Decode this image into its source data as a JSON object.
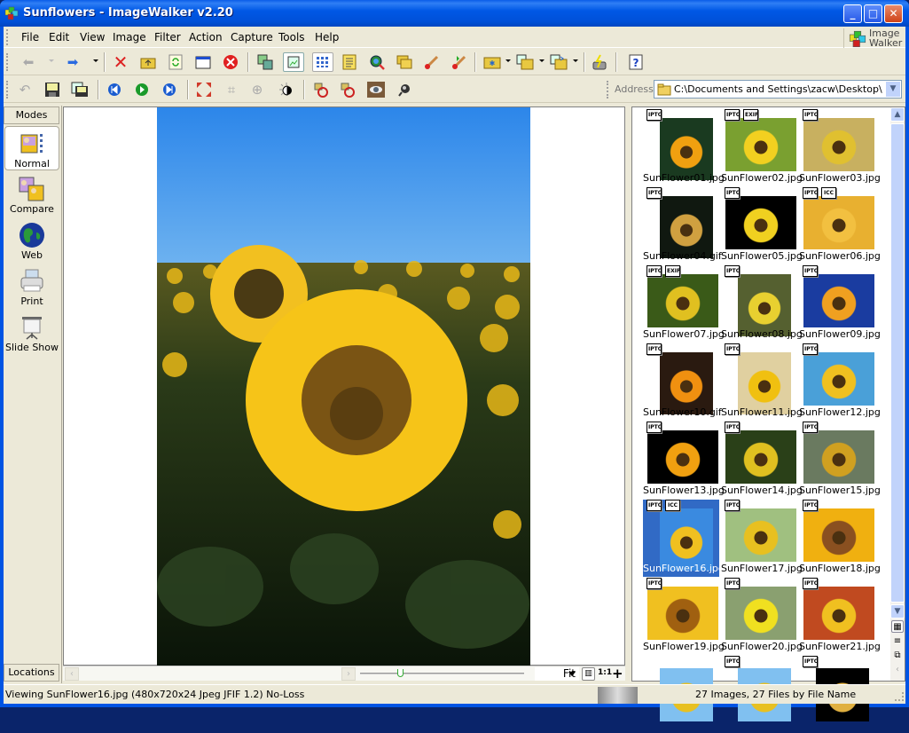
{
  "window": {
    "title": "Sunflowers - ImageWalker v2.20",
    "minimize_label": "_",
    "maximize_label": "□",
    "close_label": "✕"
  },
  "logo": {
    "line1": "Image",
    "line2": "Walker"
  },
  "menu": [
    "File",
    "Edit",
    "View",
    "Image",
    "Filter",
    "Action",
    "Capture",
    "Tools",
    "Help"
  ],
  "toolbar1": {
    "icons": [
      "back-icon",
      "forward-icon",
      "delete-icon",
      "up-folder-icon",
      "refresh-icon",
      "new-window-icon",
      "close-image-icon",
      "batch-convert-icon",
      "single-view-icon",
      "thumbnail-view-icon",
      "notes-icon",
      "web-search-icon",
      "folders-icon",
      "touch-up-icon",
      "auto-touch-up-icon",
      "new-folder-icon",
      "copy-to-icon",
      "move-to-icon",
      "capture-icon",
      "help-icon"
    ]
  },
  "toolbar2": {
    "icons": [
      "undo-icon",
      "save-icon",
      "save-as-icon",
      "previous-image-icon",
      "play-slideshow-icon",
      "next-image-icon",
      "fit-icon",
      "crop-icon",
      "resize-icon",
      "brightness-icon",
      "rotate-left-icon",
      "rotate-right-icon",
      "red-eye-icon",
      "effects-icon"
    ],
    "address_label": "Address",
    "address_value": "C:\\Documents and Settings\\zacw\\Desktop\\Images"
  },
  "modes": {
    "header": "Modes",
    "items": [
      {
        "label": "Normal",
        "icon": "normal-mode-icon",
        "active": true
      },
      {
        "label": "Compare",
        "icon": "compare-mode-icon",
        "active": false
      },
      {
        "label": "Web",
        "icon": "globe-icon",
        "active": false
      },
      {
        "label": "Print",
        "icon": "printer-icon",
        "active": false
      },
      {
        "label": "Slide Show",
        "icon": "slide-show-icon",
        "active": false
      }
    ],
    "locations_label": "Locations"
  },
  "viewer": {
    "zoom_value": "Fit",
    "zoom_fit_label": "▥",
    "zoom_actual_label": "1:1",
    "zoom_in_label": "+",
    "zoom_slider_fraction": 0.25
  },
  "thumbnails": [
    {
      "name": "SunFlower01.jpg",
      "badges": [
        "IPTC"
      ],
      "selected": false
    },
    {
      "name": "SunFlower02.jpg",
      "badges": [
        "IPTC",
        "EXIF"
      ],
      "selected": false
    },
    {
      "name": "SunFlower03.jpg",
      "badges": [
        "IPTC"
      ],
      "selected": false
    },
    {
      "name": "SunFlower04.gif",
      "badges": [
        "IPTC"
      ],
      "selected": false
    },
    {
      "name": "SunFlower05.jpg",
      "badges": [
        "IPTC"
      ],
      "selected": false
    },
    {
      "name": "SunFlower06.jpg",
      "badges": [
        "IPTC",
        "ICC"
      ],
      "selected": false
    },
    {
      "name": "SunFlower07.jpg",
      "badges": [
        "IPTC",
        "EXIF"
      ],
      "selected": false
    },
    {
      "name": "SunFlower08.jpg",
      "badges": [
        "IPTC"
      ],
      "selected": false
    },
    {
      "name": "SunFlower09.jpg",
      "badges": [
        "IPTC"
      ],
      "selected": false
    },
    {
      "name": "SunFlower10.gif",
      "badges": [
        "IPTC"
      ],
      "selected": false
    },
    {
      "name": "SunFlower11.jpg",
      "badges": [
        "IPTC"
      ],
      "selected": false
    },
    {
      "name": "SunFlower12.jpg",
      "badges": [
        "IPTC"
      ],
      "selected": false
    },
    {
      "name": "SunFlower13.jpg",
      "badges": [
        "IPTC"
      ],
      "selected": false
    },
    {
      "name": "SunFlower14.jpg",
      "badges": [
        "IPTC"
      ],
      "selected": false
    },
    {
      "name": "SunFlower15.jpg",
      "badges": [
        "IPTC"
      ],
      "selected": false
    },
    {
      "name": "SunFlower16.jpg",
      "badges": [
        "IPTC",
        "ICC"
      ],
      "selected": true
    },
    {
      "name": "SunFlower17.jpg",
      "badges": [
        "IPTC"
      ],
      "selected": false
    },
    {
      "name": "SunFlower18.jpg",
      "badges": [
        "IPTC"
      ],
      "selected": false
    },
    {
      "name": "SunFlower19.jpg",
      "badges": [
        "IPTC"
      ],
      "selected": false
    },
    {
      "name": "SunFlower20.jpg",
      "badges": [
        "IPTC"
      ],
      "selected": false
    },
    {
      "name": "SunFlower21.jpg",
      "badges": [
        "IPTC"
      ],
      "selected": false
    },
    {
      "name": "",
      "badges": [],
      "selected": false
    },
    {
      "name": "",
      "badges": [
        "IPTC"
      ],
      "selected": false
    },
    {
      "name": "",
      "badges": [
        "IPTC"
      ],
      "selected": false
    }
  ],
  "status": {
    "left": "Viewing SunFlower16.jpg (480x720x24 Jpeg JFIF 1.2) No-Loss",
    "right": "27 Images, 27 Files by File Name"
  },
  "colors": {
    "title_bar": "#0058e6",
    "selection": "#316ac5",
    "chrome": "#ece9d8"
  }
}
